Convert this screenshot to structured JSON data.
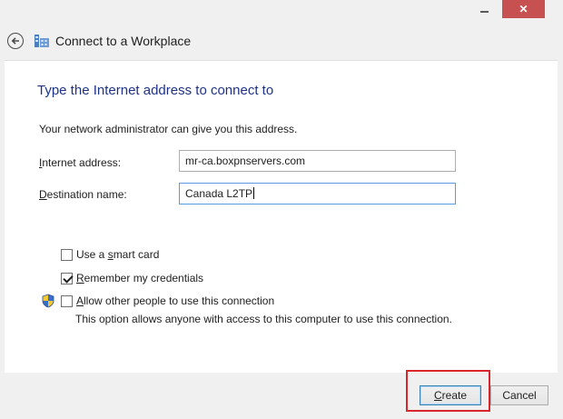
{
  "window": {
    "title": "Connect to a Workplace",
    "minimize_icon": "minimize-icon",
    "close_icon": "close-icon",
    "close_color": "#c75050"
  },
  "page": {
    "heading": "Type the Internet address to connect to",
    "subtext": "Your network administrator can give you this address.",
    "heading_color": "#1e3287"
  },
  "fields": {
    "internet_address": {
      "label_pre": "",
      "label_mnemonic": "I",
      "label_post": "nternet address:",
      "value": "mr-ca.boxpnservers.com"
    },
    "destination_name": {
      "label_pre": "",
      "label_mnemonic": "D",
      "label_post": "estination name:",
      "value": "Canada L2TP"
    }
  },
  "options": {
    "smart_card": {
      "label_pre": "Use a ",
      "label_mnemonic": "s",
      "label_post": "mart card",
      "checked": false
    },
    "remember": {
      "label_pre": "",
      "label_mnemonic": "R",
      "label_post": "emember my credentials",
      "checked": true
    },
    "allow_others": {
      "label_pre": "",
      "label_mnemonic": "A",
      "label_post": "llow other people to use this connection",
      "checked": false,
      "description": "This option allows anyone with access to this computer to use this connection."
    }
  },
  "buttons": {
    "create_pre": "",
    "create_mnemonic": "C",
    "create_post": "reate",
    "cancel": "Cancel"
  },
  "annotation": {
    "highlight_color": "#d9262c"
  }
}
